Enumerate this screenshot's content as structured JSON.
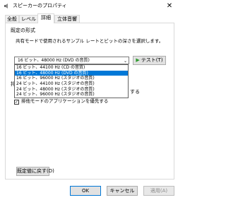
{
  "window": {
    "title": "スピーカーのプロパティ",
    "close_glyph": "✕"
  },
  "tabs": [
    {
      "label": "全般"
    },
    {
      "label": "レベル"
    },
    {
      "label": "詳細"
    },
    {
      "label": "立体音響"
    }
  ],
  "default_format": {
    "title": "既定の形式",
    "description": "共有モードで使用されるサンプル レートとビットの深さを選択します。",
    "selected_value": "16 ビット、48000 Hz (DVD の音質)",
    "options": [
      "16 ビット、44100 Hz (CD の音質)",
      "16 ビット、48000 Hz (DVD の音質)",
      "16 ビット、96000 Hz (スタジオの音質)",
      "24 ビット、44100 Hz (スタジオの音質)",
      "24 ビット、48000 Hz (スタジオの音質)",
      "24 ビット、96000 Hz (スタジオの音質)"
    ],
    "test_button": "テスト(T)"
  },
  "exclusive_mode": {
    "title": "排",
    "option1_suffix": "する",
    "option2_label": "排他モードのアプリケーションを優先する",
    "option1_checked": true,
    "option2_checked": true
  },
  "restore_defaults_button": "既定値に戻す(D)",
  "footer": {
    "ok": "OK",
    "cancel": "キャンセル",
    "apply": "適用(A)"
  }
}
